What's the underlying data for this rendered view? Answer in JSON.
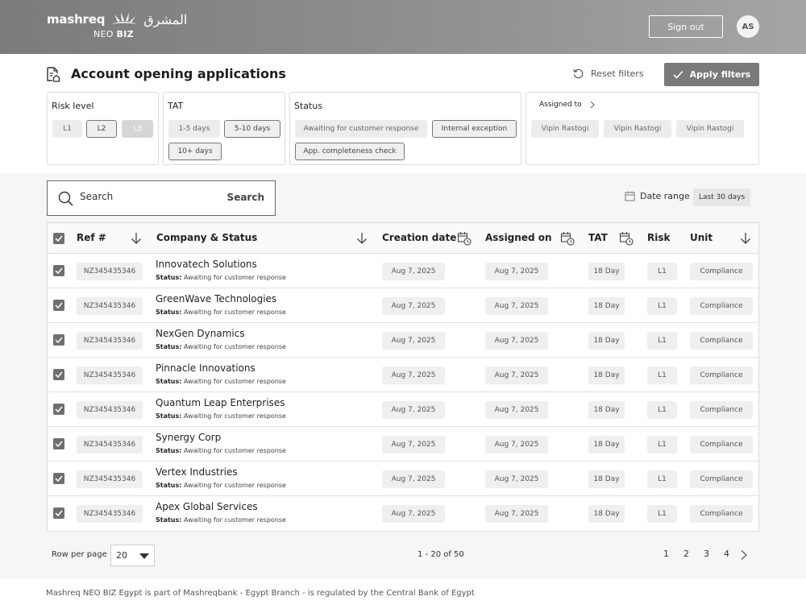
{
  "header": {
    "logo_latin": "mashreq",
    "logo_arabic": "المشرق",
    "logo_sub_light": "NEO",
    "logo_sub_bold": "BIZ",
    "signout_label": "Sign out",
    "avatar_initials": "AS"
  },
  "page": {
    "title": "Account opening applications",
    "reset_label": "Reset filters",
    "apply_label": "Apply filters"
  },
  "filters": {
    "risk": {
      "title": "Risk level",
      "options": [
        "L1",
        "L2",
        "L3"
      ],
      "selected": "L2",
      "disabled": "L3"
    },
    "tat": {
      "title": "TAT",
      "options": [
        "1-5 days",
        "5-10 days",
        "10+ days"
      ],
      "selected": [
        "5-10 days",
        "10+ days"
      ]
    },
    "status": {
      "title": "Status",
      "options": [
        "Awaiting for customer response",
        "Internal exception",
        "App. completeness check"
      ],
      "selected": [
        "Internal exception",
        "App. completeness check"
      ]
    },
    "assigned": {
      "title": "Assigned to",
      "options": [
        "Vipin Rastogi",
        "Vipin Rastogi",
        "Vipin Rastogi"
      ]
    }
  },
  "search": {
    "placeholder": "Search",
    "button_label": "Search"
  },
  "date_range": {
    "label": "Date range",
    "value": "Last 30 days"
  },
  "table": {
    "columns": [
      "Ref #",
      "Company & Status",
      "Creation date",
      "Assigned on",
      "TAT",
      "Risk",
      "Unit"
    ],
    "status_prefix": "Status:",
    "rows": [
      {
        "ref": "NZ345435346",
        "company": "Innovatech Solutions",
        "status": "Awaiting for customer response",
        "created": "Aug 7, 2025",
        "assigned": "Aug 7, 2025",
        "tat": "18 Day",
        "risk": "L1",
        "unit": "Compliance"
      },
      {
        "ref": "NZ345435346",
        "company": "GreenWave Technologies",
        "status": "Awaiting for customer response",
        "created": "Aug 7, 2025",
        "assigned": "Aug 7, 2025",
        "tat": "18 Day",
        "risk": "L1",
        "unit": "Compliance"
      },
      {
        "ref": "NZ345435346",
        "company": "NexGen Dynamics",
        "status": "Awaiting for customer response",
        "created": "Aug 7, 2025",
        "assigned": "Aug 7, 2025",
        "tat": "18 Day",
        "risk": "L1",
        "unit": "Compliance"
      },
      {
        "ref": "NZ345435346",
        "company": "Pinnacle Innovations",
        "status": "Awaiting for customer response",
        "created": "Aug 7, 2025",
        "assigned": "Aug 7, 2025",
        "tat": "18 Day",
        "risk": "L1",
        "unit": "Compliance"
      },
      {
        "ref": "NZ345435346",
        "company": "Quantum Leap Enterprises",
        "status": "Awaiting for customer response",
        "created": "Aug 7, 2025",
        "assigned": "Aug 7, 2025",
        "tat": "18 Day",
        "risk": "L1",
        "unit": "Compliance"
      },
      {
        "ref": "NZ345435346",
        "company": "Synergy Corp",
        "status": "Awaiting for customer response",
        "created": "Aug 7, 2025",
        "assigned": "Aug 7, 2025",
        "tat": "18 Day",
        "risk": "L1",
        "unit": "Compliance"
      },
      {
        "ref": "NZ345435346",
        "company": "Vertex Industries",
        "status": "Awaiting for customer response",
        "created": "Aug 7, 2025",
        "assigned": "Aug 7, 2025",
        "tat": "18 Day",
        "risk": "L1",
        "unit": "Compliance"
      },
      {
        "ref": "NZ345435346",
        "company": "Apex Global Services",
        "status": "Awaiting for customer response",
        "created": "Aug 7, 2025",
        "assigned": "Aug 7, 2025",
        "tat": "18 Day",
        "risk": "L1",
        "unit": "Compliance"
      }
    ]
  },
  "pagination": {
    "rows_per_page_label": "Row per page",
    "rows_per_page_value": "20",
    "range_text": "1 - 20 of 50",
    "pages": [
      "1",
      "2",
      "3",
      "4"
    ]
  },
  "footer": {
    "text": "Mashreq NEO BIZ Egypt is part of Mashreqbank - Egypt Branch - is regulated by the Central Bank of Egypt"
  }
}
